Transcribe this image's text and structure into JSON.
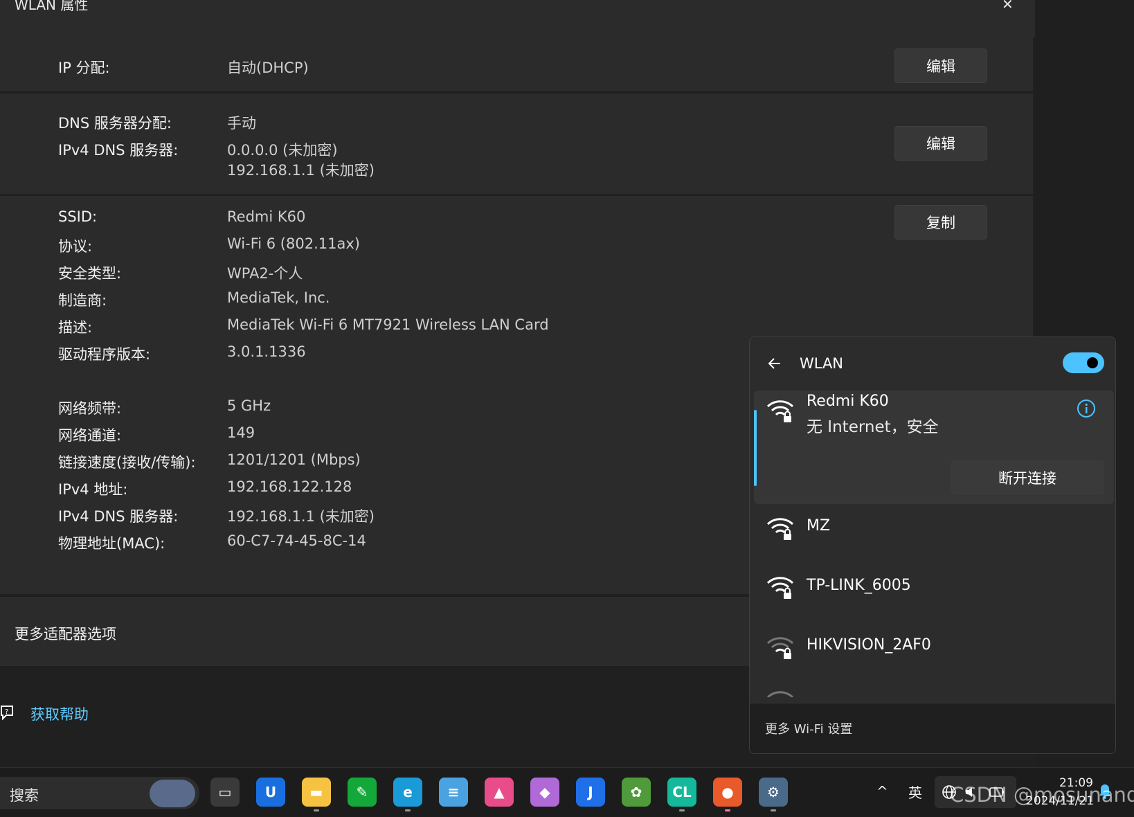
{
  "window": {
    "title": "WLAN 属性",
    "close_glyph": "✕"
  },
  "ip_section": {
    "label": "IP 分配:",
    "value": "自动(DHCP)",
    "button": "编辑"
  },
  "dns_section": {
    "label1": "DNS 服务器分配:",
    "value1": "手动",
    "label2": "IPv4 DNS 服务器:",
    "value2a": "0.0.0.0 (未加密)",
    "value2b": "192.168.1.1 (未加密)",
    "button": "编辑"
  },
  "details_section": {
    "button": "复制",
    "rows": [
      {
        "label": "SSID:",
        "value": "Redmi K60"
      },
      {
        "label": "协议:",
        "value": "Wi-Fi 6 (802.11ax)"
      },
      {
        "label": "安全类型:",
        "value": "WPA2-个人"
      },
      {
        "label": "制造商:",
        "value": "MediaTek, Inc."
      },
      {
        "label": "描述:",
        "value": "MediaTek Wi-Fi 6 MT7921 Wireless LAN Card"
      },
      {
        "label": "驱动程序版本:",
        "value": "3.0.1.1336"
      },
      {
        "label": "网络频带:",
        "value": "5 GHz"
      },
      {
        "label": "网络通道:",
        "value": "149"
      },
      {
        "label": "链接速度(接收/传输):",
        "value": "1201/1201 (Mbps)"
      },
      {
        "label": "IPv4 地址:",
        "value": "192.168.122.128"
      },
      {
        "label": "IPv4 DNS 服务器:",
        "value": "192.168.1.1 (未加密)"
      },
      {
        "label": "物理地址(MAC):",
        "value": "60-C7-74-45-8C-14"
      }
    ]
  },
  "more_adapter": "更多适配器选项",
  "help": {
    "link": "获取帮助",
    "icon": "help-chat-icon"
  },
  "flyout": {
    "title": "WLAN",
    "toggle_on": true,
    "accent": "#4cc2ff",
    "connected": {
      "name": "Redmi K60",
      "status": "无 Internet，安全",
      "disconnect": "断开连接"
    },
    "networks": [
      "MZ",
      "TP-LINK_6005",
      "HIKVISION_2AF0"
    ],
    "footer": "更多 Wi-Fi 设置"
  },
  "taskbar": {
    "search_label": "搜索",
    "apps": [
      {
        "name": "task-view-icon",
        "glyph": "▭",
        "bg": "#3a3a3a"
      },
      {
        "name": "lenovo-u-icon",
        "glyph": "U",
        "bg": "#1a6fe0"
      },
      {
        "name": "file-explorer-icon",
        "glyph": "▬",
        "bg": "#f5c242"
      },
      {
        "name": "evernote-icon",
        "glyph": "✎",
        "bg": "#14a83b"
      },
      {
        "name": "edge-icon",
        "glyph": "e",
        "bg": "#1a9ad6"
      },
      {
        "name": "notepad-icon",
        "glyph": "≡",
        "bg": "#4aa3e0"
      },
      {
        "name": "color-app-icon",
        "glyph": "▲",
        "bg": "#e84d8a"
      },
      {
        "name": "media-app-icon",
        "glyph": "◆",
        "bg": "#b06ad8"
      },
      {
        "name": "j-app-icon",
        "glyph": "J",
        "bg": "#1e6fe8"
      },
      {
        "name": "image-editor-icon",
        "glyph": "✿",
        "bg": "#4f9a3a"
      },
      {
        "name": "clion-icon",
        "glyph": "CL",
        "bg": "#14b89a"
      },
      {
        "name": "firefox-icon",
        "glyph": "●",
        "bg": "#e8592c"
      },
      {
        "name": "settings-gear-icon",
        "glyph": "⚙",
        "bg": "#4a6a8a"
      }
    ],
    "tray": {
      "chevron": "^",
      "ime": "英"
    },
    "time": "21:09",
    "date": "2024/11/21",
    "watermark": "CSDN @mosunand"
  }
}
